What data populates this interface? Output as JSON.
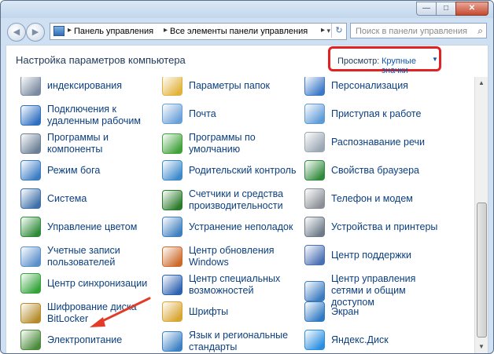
{
  "window": {
    "min": "—",
    "max": "□",
    "close": "✕"
  },
  "nav": {
    "back": "◀",
    "fwd": "▶"
  },
  "address": {
    "crumb1": "Панель управления",
    "crumb2": "Все элементы панели управления",
    "sep": "▸",
    "dropdown": "▾",
    "refresh": "↻"
  },
  "search": {
    "placeholder": "Поиск в панели управления",
    "icon": "search-icon"
  },
  "header": {
    "title": "Настройка параметров компьютера",
    "view_label": "Просмотр:",
    "view_value": "Крупные значки",
    "caret": "▼"
  },
  "items": [
    {
      "label": "индексирования",
      "icon": "indexing-icon",
      "color": "#7a8aa0"
    },
    {
      "label": "Параметры папок",
      "icon": "folder-options-icon",
      "color": "#e2b33c"
    },
    {
      "label": "Персонализация",
      "icon": "personalization-icon",
      "color": "#3a78c8"
    },
    {
      "label": "Подключения к удаленным рабочим",
      "icon": "remote-desktop-icon",
      "color": "#2f6fc0"
    },
    {
      "label": "Почта",
      "icon": "mail-icon",
      "color": "#6aa0d8"
    },
    {
      "label": "Приступая к работе",
      "icon": "getting-started-icon",
      "color": "#5d9ad6"
    },
    {
      "label": "Программы и компоненты",
      "icon": "programs-icon",
      "color": "#6b7f95"
    },
    {
      "label": "Программы по умолчанию",
      "icon": "default-programs-icon",
      "color": "#3fa23a"
    },
    {
      "label": "Распознавание речи",
      "icon": "speech-icon",
      "color": "#9aa6b2"
    },
    {
      "label": "Режим бога",
      "icon": "god-mode-icon",
      "color": "#3b7cc4"
    },
    {
      "label": "Родительский контроль",
      "icon": "parental-control-icon",
      "color": "#3d8acb"
    },
    {
      "label": "Свойства браузера",
      "icon": "browser-properties-icon",
      "color": "#2f8a3c"
    },
    {
      "label": "Система",
      "icon": "system-icon",
      "color": "#3e6fa8"
    },
    {
      "label": "Счетчики и средства производительности",
      "icon": "performance-icon",
      "color": "#2b7a2b"
    },
    {
      "label": "Телефон и модем",
      "icon": "phone-modem-icon",
      "color": "#8a8f96"
    },
    {
      "label": "Управление цветом",
      "icon": "color-management-icon",
      "color": "#2e8b3a"
    },
    {
      "label": "Устранение неполадок",
      "icon": "troubleshooting-icon",
      "color": "#3f7fbf"
    },
    {
      "label": "Устройства и принтеры",
      "icon": "devices-printers-icon",
      "color": "#6d7a88"
    },
    {
      "label": "Учетные записи пользователей",
      "icon": "user-accounts-icon",
      "color": "#5a8fc9"
    },
    {
      "label": "Центр обновления Windows",
      "icon": "windows-update-icon",
      "color": "#cc6a2a"
    },
    {
      "label": "Центр поддержки",
      "icon": "action-center-icon",
      "color": "#4a6fb3"
    },
    {
      "label": "Центр синхронизации",
      "icon": "sync-center-icon",
      "color": "#33a33a"
    },
    {
      "label": "Центр специальных возможностей",
      "icon": "ease-of-access-icon",
      "color": "#2c62b0"
    },
    {
      "label": "Центр управления сетями и общим доступом",
      "icon": "network-center-icon",
      "color": "#3a7ac0"
    },
    {
      "label": "Шифрование диска BitLocker",
      "icon": "bitlocker-icon",
      "color": "#b48b2a"
    },
    {
      "label": "Шрифты",
      "icon": "fonts-icon",
      "color": "#d8a530"
    },
    {
      "label": "Экран",
      "icon": "display-icon",
      "color": "#2f79c2"
    },
    {
      "label": "Электропитание",
      "icon": "power-options-icon",
      "color": "#4a8a3a"
    },
    {
      "label": "Язык и региональные стандарты",
      "icon": "region-language-icon",
      "color": "#3b80c4"
    },
    {
      "label": "Яндекс.Диск",
      "icon": "yandex-disk-icon",
      "color": "#2a8ee0"
    }
  ],
  "scrollbar": {
    "up": "▲",
    "down": "▼"
  }
}
